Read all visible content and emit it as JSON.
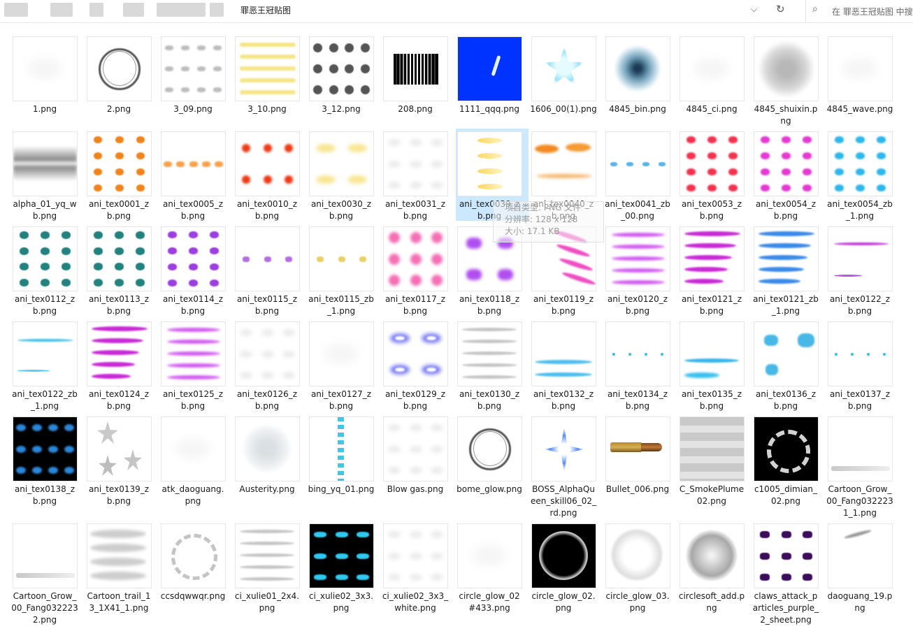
{
  "titlebar": {
    "folder": "罪恶王冠贴图",
    "search_placeholder": "在 罪恶王冠贴图 中搜索"
  },
  "tooltip": {
    "line1": "项目类型: PNG 文件",
    "line2": "分辨率: 128 x 128",
    "line3": "大小: 17.1 KB"
  },
  "files": [
    {
      "name": "1.png",
      "icon": "faint-blank",
      "bg": "#ffffff"
    },
    {
      "name": "2.png",
      "icon": "ring",
      "bg": "#ffffff"
    },
    {
      "name": "3_09.png",
      "icon": "gray-wisps",
      "bg": "#ffffff"
    },
    {
      "name": "3_10.png",
      "icon": "yellow-streaks",
      "bg": "#ffffff"
    },
    {
      "name": "3_12.png",
      "icon": "gray-smoke-grid",
      "bg": "#ffffff"
    },
    {
      "name": "208.png",
      "icon": "bw-stripes",
      "bg": "#ffffff"
    },
    {
      "name": "1111_qqq.png",
      "icon": "blue-square",
      "bg": "#0033ff"
    },
    {
      "name": "1606_00(1).png",
      "icon": "cyan-star",
      "bg": "#ffffff"
    },
    {
      "name": "4845_bin.png",
      "icon": "blue-shards",
      "bg": "#ffffff"
    },
    {
      "name": "4845_ci.png",
      "icon": "faint-blank",
      "bg": "#ffffff"
    },
    {
      "name": "4845_shuixin.png",
      "icon": "gray-cloud",
      "bg": "#ffffff"
    },
    {
      "name": "4845_wave.png",
      "icon": "faint-blank",
      "bg": "#ffffff"
    },
    {
      "name": "alpha_01_yq_wb.png",
      "icon": "gray-band",
      "bg": "#ffffff"
    },
    {
      "name": "ani_tex0001_zb.png",
      "icon": "orange-grid",
      "bg": "#ffffff"
    },
    {
      "name": "ani_tex0005_zb.png",
      "icon": "orange-row",
      "bg": "#ffffff"
    },
    {
      "name": "ani_tex0010_zb.png",
      "icon": "red-dots",
      "bg": "#ffffff"
    },
    {
      "name": "ani_tex0030_zb.png",
      "icon": "yellow-glow",
      "bg": "#ffffff"
    },
    {
      "name": "ani_tex0031_zb.png",
      "icon": "faint-wisps",
      "bg": "#ffffff"
    },
    {
      "name": "ani_tex0039_zb.png",
      "icon": "yellow-flames",
      "bg": "#ffffff",
      "selected": true
    },
    {
      "name": "ani_tex0040_zb.png",
      "icon": "orange-fire",
      "bg": "#ffffff"
    },
    {
      "name": "ani_tex0041_zb_00.png",
      "icon": "blue-splash-row",
      "bg": "#ffffff"
    },
    {
      "name": "ani_tex0053_zb.png",
      "icon": "red-grid",
      "bg": "#ffffff"
    },
    {
      "name": "ani_tex0054_zb.png",
      "icon": "magenta-grid",
      "bg": "#ffffff"
    },
    {
      "name": "ani_tex0054_zb_1.png",
      "icon": "cyan-grid",
      "bg": "#ffffff"
    },
    {
      "name": "ani_tex0112_zb.png",
      "icon": "teal-grid",
      "bg": "#ffffff"
    },
    {
      "name": "ani_tex0113_zb.png",
      "icon": "teal-grid",
      "bg": "#ffffff"
    },
    {
      "name": "ani_tex0114_zb.png",
      "icon": "purple-grid",
      "bg": "#ffffff"
    },
    {
      "name": "ani_tex0115_zb.png",
      "icon": "purple-row",
      "bg": "#ffffff"
    },
    {
      "name": "ani_tex0115_zb_1.png",
      "icon": "yellow-row",
      "bg": "#ffffff"
    },
    {
      "name": "ani_tex0117_zb.png",
      "icon": "pink-bursts",
      "bg": "#ffffff"
    },
    {
      "name": "ani_tex0118_zb.png",
      "icon": "violet-bursts",
      "bg": "#ffffff"
    },
    {
      "name": "ani_tex0119_zb.png",
      "icon": "pink-streaks",
      "bg": "#ffffff"
    },
    {
      "name": "ani_tex0120_zb.png",
      "icon": "violet-streaks",
      "bg": "#ffffff"
    },
    {
      "name": "ani_tex0121_zb.png",
      "icon": "magenta-streaks",
      "bg": "#ffffff"
    },
    {
      "name": "ani_tex0121_zb_1.png",
      "icon": "blue-streaks",
      "bg": "#ffffff"
    },
    {
      "name": "ani_tex0122_zb.png",
      "icon": "magenta-lines",
      "bg": "#ffffff"
    },
    {
      "name": "ani_tex0122_zb_1.png",
      "icon": "cyan-lines",
      "bg": "#ffffff"
    },
    {
      "name": "ani_tex0124_zb.png",
      "icon": "magenta-streaks",
      "bg": "#ffffff"
    },
    {
      "name": "ani_tex0125_zb.png",
      "icon": "violet-streaks",
      "bg": "#ffffff"
    },
    {
      "name": "ani_tex0126_zb.png",
      "icon": "faint-wisps",
      "bg": "#ffffff"
    },
    {
      "name": "ani_tex0127_zb.png",
      "icon": "faint-blank",
      "bg": "#ffffff"
    },
    {
      "name": "ani_tex0129_zb.png",
      "icon": "blue-glow",
      "bg": "#ffffff"
    },
    {
      "name": "ani_tex0130_zb.png",
      "icon": "gray-streaks",
      "bg": "#ffffff"
    },
    {
      "name": "ani_tex0132_zb.png",
      "icon": "cyan-row",
      "bg": "#ffffff"
    },
    {
      "name": "ani_tex0134_zb.png",
      "icon": "cyan-sparkles",
      "bg": "#ffffff"
    },
    {
      "name": "ani_tex0135_zb.png",
      "icon": "cyan-comet",
      "bg": "#ffffff"
    },
    {
      "name": "ani_tex0136_zb.png",
      "icon": "cyan-stars",
      "bg": "#ffffff"
    },
    {
      "name": "ani_tex0137_zb.png",
      "icon": "cyan-sparkles",
      "bg": "#ffffff"
    },
    {
      "name": "ani_tex0138_zb.png",
      "icon": "dark-blue-rings",
      "bg": "#000000"
    },
    {
      "name": "ani_tex0139_zb.png",
      "icon": "gray-stars",
      "bg": "#ffffff"
    },
    {
      "name": "atk_daoguang.png",
      "icon": "faint-blank",
      "bg": "#ffffff"
    },
    {
      "name": "Austerity.png",
      "icon": "faint-cloud",
      "bg": "#ffffff"
    },
    {
      "name": "bing_yq_01.png",
      "icon": "cyan-column",
      "bg": "#ffffff"
    },
    {
      "name": "Blow gas.png",
      "icon": "faint-wisps",
      "bg": "#ffffff"
    },
    {
      "name": "bome_glow.png",
      "icon": "ring",
      "bg": "#ffffff"
    },
    {
      "name": "BOSS_AlphaQueen_skill06_02_rd.png",
      "icon": "blue-sparkle",
      "bg": "#ffffff"
    },
    {
      "name": "Bullet_006.png",
      "icon": "bullet",
      "bg": "#ffffff"
    },
    {
      "name": "C_SmokePlume02.png",
      "icon": "gray-bars",
      "bg": "#ffffff"
    },
    {
      "name": "c1005_dimian_02.png",
      "icon": "black-ring",
      "bg": "#000000"
    },
    {
      "name": "Cartoon_Grow_00_Fang0322231_1.png",
      "icon": "gray-thin-bar",
      "bg": "#ffffff"
    },
    {
      "name": "Cartoon_Grow_00_Fang0322232.png",
      "icon": "gray-thin-bar",
      "bg": "#ffffff"
    },
    {
      "name": "Cartoon_trail_13_1X41_1.png",
      "icon": "gray-trail",
      "bg": "#ffffff"
    },
    {
      "name": "ccsdqwwqr.png",
      "icon": "dashed-ring",
      "bg": "#ffffff"
    },
    {
      "name": "ci_xulie01_2x4.png",
      "icon": "gray-streaks",
      "bg": "#ffffff"
    },
    {
      "name": "ci_xulie02_3x3.png",
      "icon": "cyan-on-black",
      "bg": "#000000"
    },
    {
      "name": "ci_xulie02_3x3_white.png",
      "icon": "faint-wisps",
      "bg": "#ffffff"
    },
    {
      "name": "circle_glow_02#433.png",
      "icon": "faint-blank",
      "bg": "#ffffff"
    },
    {
      "name": "circle_glow_02.png",
      "icon": "glow-circle",
      "bg": "#000000"
    },
    {
      "name": "circle_glow_03.png",
      "icon": "faint-circle",
      "bg": "#ffffff"
    },
    {
      "name": "circlesoft_add.png",
      "icon": "soft-circle",
      "bg": "#ffffff"
    },
    {
      "name": "claws_attack_particles_purple_2_sheet.png",
      "icon": "purple-claws",
      "bg": "#ffffff"
    },
    {
      "name": "daoguang_19.png",
      "icon": "gray-slash",
      "bg": "#ffffff"
    }
  ]
}
